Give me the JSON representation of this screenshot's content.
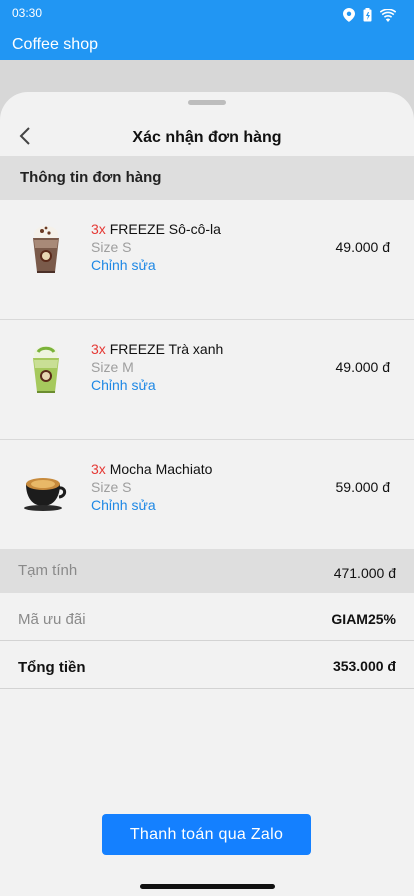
{
  "status_bar": {
    "time": "03:30"
  },
  "app": {
    "title": "Coffee shop"
  },
  "sheet": {
    "title": "Xác nhận đơn hàng"
  },
  "section": {
    "order_info": "Thông tin đơn hàng"
  },
  "items": [
    {
      "qty": "3x",
      "name": "FREEZE Sô-cô-la",
      "size": "Size S",
      "edit": "Chỉnh sửa",
      "price": "49.000 đ",
      "image": "chocolate-freeze"
    },
    {
      "qty": "3x",
      "name": "FREEZE Trà xanh",
      "size": "Size M",
      "edit": "Chỉnh sửa",
      "price": "49.000 đ",
      "image": "green-tea-freeze"
    },
    {
      "qty": "3x",
      "name": "Mocha Machiato",
      "size": "Size S",
      "edit": "Chỉnh sửa",
      "price": "59.000 đ",
      "image": "mocha-cup"
    }
  ],
  "summary": {
    "subtotal_label": "Tạm tính",
    "subtotal_value": "471.000 đ",
    "promo_label": "Mã ưu đãi",
    "promo_value": "GIAM25%",
    "total_label": "Tổng tiền",
    "total_value": "353.000 đ"
  },
  "actions": {
    "pay": "Thanh toán qua Zalo"
  },
  "colors": {
    "header": "#2196f3",
    "qty": "#e53935",
    "link": "#1e88e5",
    "button": "#1480ff"
  }
}
